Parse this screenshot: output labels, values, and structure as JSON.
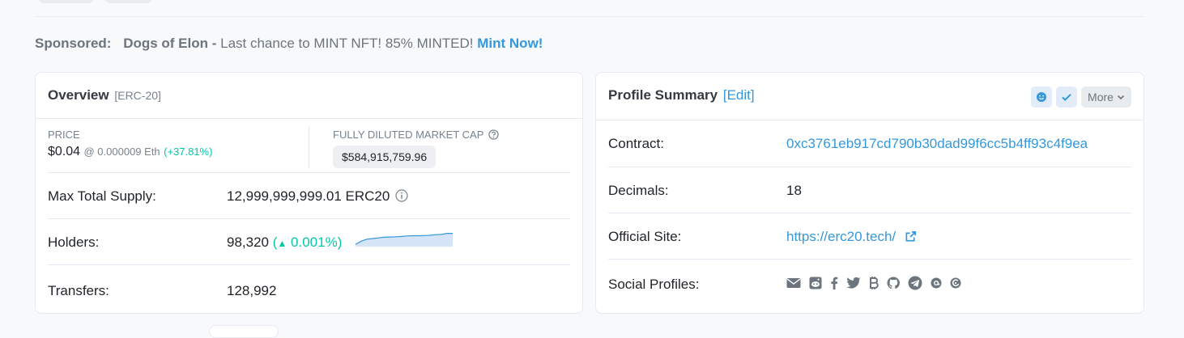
{
  "sponsored": {
    "label": "Sponsored:",
    "name": "Dogs of Elon",
    "separator": " - ",
    "text": "Last chance to MINT NFT! 85% MINTED!",
    "link": "Mint Now!"
  },
  "overview": {
    "title": "Overview",
    "token_type": "[ERC-20]",
    "price": {
      "label": "PRICE",
      "value": "$0.04",
      "eth": "@ 0.000009 Eth",
      "change": "(+37.81%)"
    },
    "market_cap": {
      "label": "FULLY DILUTED MARKET CAP",
      "value": "$584,915,759.96"
    },
    "rows": {
      "supply": {
        "label": "Max Total Supply:",
        "value": "12,999,999,999.01 ERC20"
      },
      "holders": {
        "label": "Holders:",
        "value": "98,320",
        "change": "0.001%"
      },
      "transfers": {
        "label": "Transfers:",
        "value": "128,992"
      }
    },
    "holders_trend": [
      0.05,
      0.3,
      0.45,
      0.5,
      0.55,
      0.6,
      0.62,
      0.64,
      0.66,
      0.7,
      0.72,
      0.72,
      0.73,
      0.75,
      0.8,
      0.82,
      0.9,
      0.9
    ]
  },
  "profile": {
    "title": "Profile Summary",
    "edit": "[Edit]",
    "more_label": "More",
    "rows": {
      "contract": {
        "label": "Contract:",
        "value": "0xc3761eb917cd790b30dad99f6cc5b4ff93c4f9ea"
      },
      "decimals": {
        "label": "Decimals:",
        "value": "18"
      },
      "site": {
        "label": "Official Site:",
        "value": "https://erc20.tech/"
      },
      "social": {
        "label": "Social Profiles:"
      }
    },
    "social_icons": [
      "email-icon",
      "reddit-icon",
      "facebook-icon",
      "twitter-icon",
      "bitcointalk-icon",
      "github-icon",
      "telegram-icon",
      "medium-icon",
      "coinmarketcap-icon"
    ]
  },
  "colors": {
    "link": "#3498db",
    "positive": "#00c9a7",
    "muted": "#77838f"
  }
}
